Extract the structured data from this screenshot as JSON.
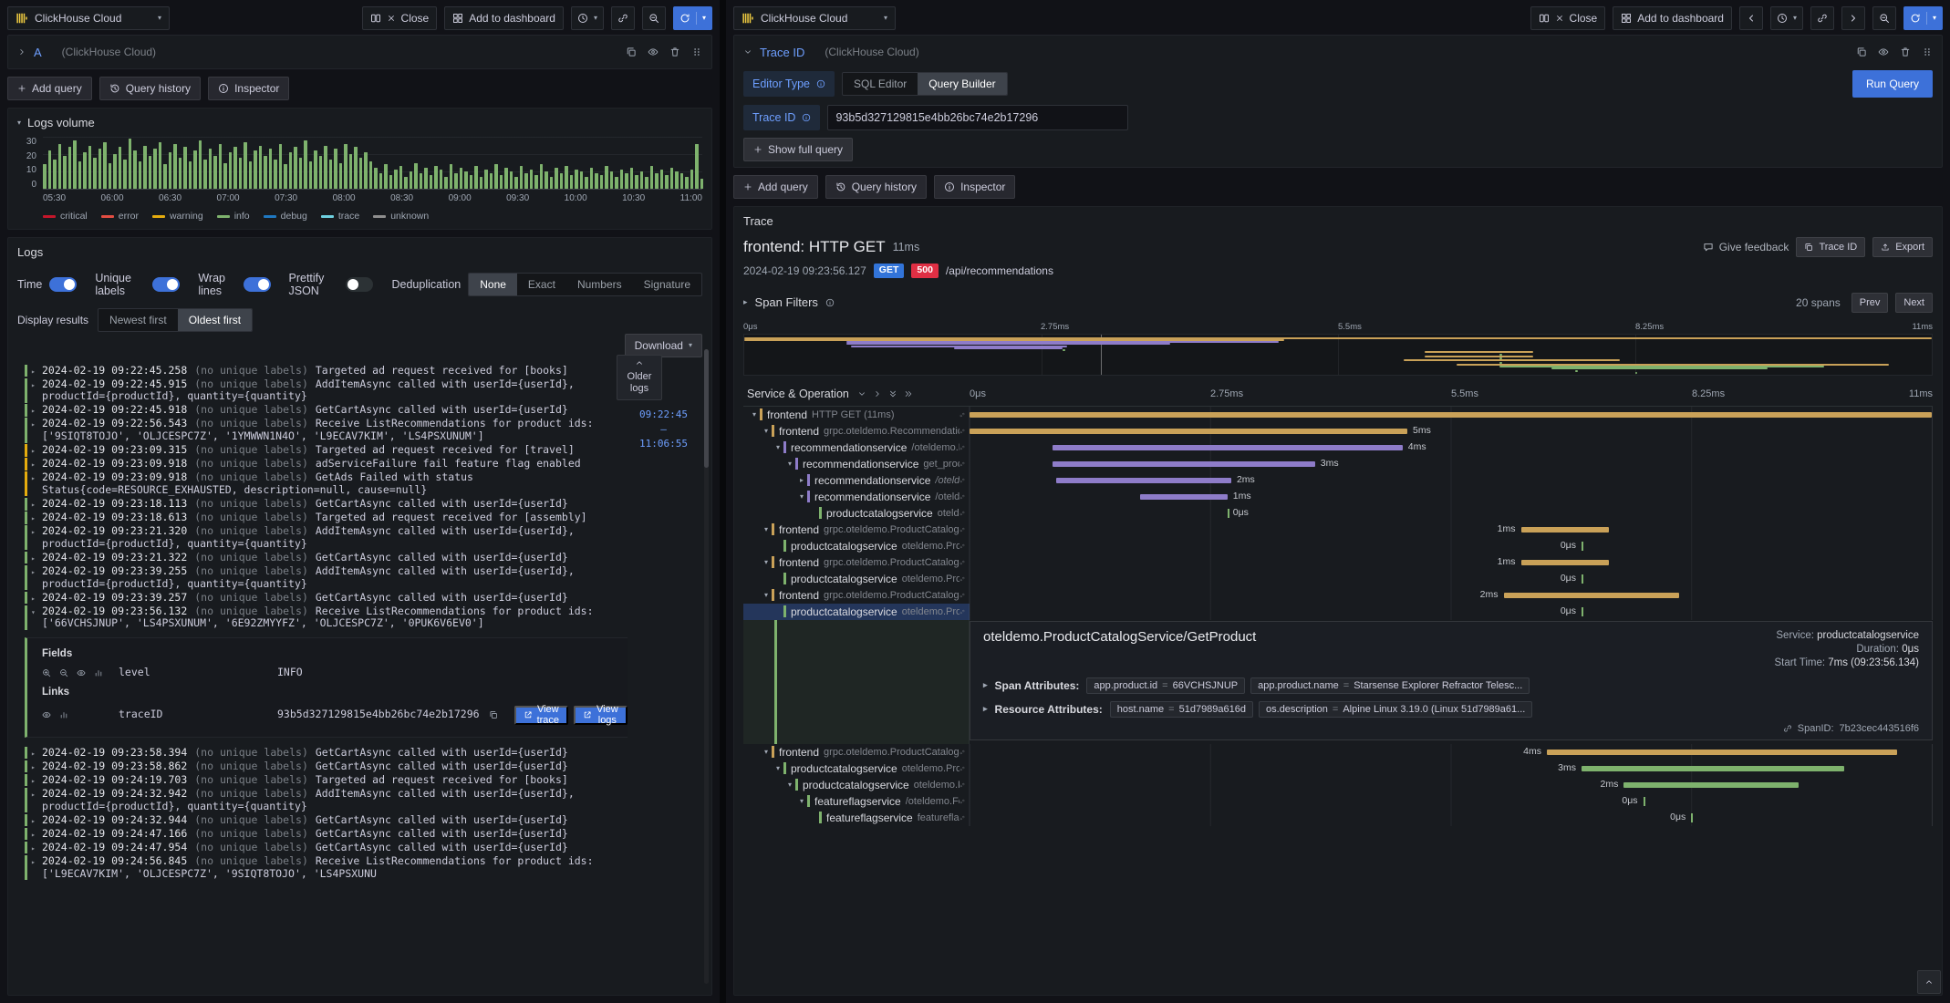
{
  "colors": {
    "accent_blue": "#3d71d9",
    "link_blue": "#6e9fff",
    "method_get": "#3274d9",
    "status_500": "#e02f44",
    "log_levels": {
      "critical": "#c4162a",
      "error": "#e24d42",
      "warning": "#e5ac0e",
      "info": "#7eb26d",
      "debug": "#1f78c1",
      "trace": "#6ed0e0",
      "unknown": "#8e8e8e"
    },
    "services": {
      "tan": "#c9a158",
      "purple": "#8e7cc9",
      "green": "#7eb26d"
    }
  },
  "chart_data": {
    "type": "bar",
    "title": "Logs volume",
    "xlabel": "time",
    "ylabel": "",
    "x_ticks": [
      "05:30",
      "06:00",
      "06:30",
      "07:00",
      "07:30",
      "08:00",
      "08:30",
      "09:00",
      "09:30",
      "10:00",
      "10:30",
      "11:00"
    ],
    "ylim": [
      0,
      30
    ],
    "y_ticks": [
      "30",
      "20",
      "10",
      "0"
    ],
    "legend": [
      "critical",
      "error",
      "warning",
      "info",
      "debug",
      "trace",
      "unknown"
    ],
    "legend_position": "bottom",
    "grid": true,
    "series": [
      {
        "name": "info",
        "color": "#7eb26d",
        "values": [
          14,
          22,
          17,
          26,
          19,
          24,
          28,
          16,
          21,
          25,
          18,
          23,
          27,
          15,
          20,
          24,
          17,
          29,
          22,
          16,
          25,
          19,
          23,
          27,
          14,
          21,
          26,
          18,
          24,
          16,
          22,
          28,
          17,
          23,
          19,
          26,
          15,
          21,
          24,
          18,
          27,
          16,
          22,
          25,
          19,
          23,
          17,
          26,
          14,
          21,
          24,
          18,
          28,
          16,
          22,
          19,
          25,
          17,
          23,
          15,
          26,
          20,
          24,
          18,
          21,
          16,
          12,
          9,
          14,
          8,
          11,
          13,
          7,
          10,
          15,
          9,
          12,
          8,
          13,
          11,
          7,
          14,
          9,
          12,
          10,
          8,
          13,
          7,
          11,
          9,
          14,
          8,
          12,
          10,
          7,
          13,
          9,
          11,
          8,
          14,
          10,
          7,
          12,
          9,
          13,
          8,
          11,
          10,
          7,
          12,
          9,
          8,
          13,
          10,
          7,
          11,
          9,
          12,
          8,
          10,
          7,
          13,
          9,
          11,
          8,
          12,
          10,
          9,
          7,
          11,
          26,
          6
        ]
      }
    ]
  },
  "left": {
    "toolbar": {
      "datasource": "ClickHouse Cloud",
      "close": "Close",
      "add_to_dashboard": "Add to dashboard"
    },
    "query": {
      "ref_id": "A",
      "hint": "(ClickHouse Cloud)"
    },
    "actions": {
      "add_query": "Add query",
      "query_history": "Query history",
      "inspector": "Inspector"
    },
    "logs_volume": {
      "title": "Logs volume"
    },
    "logs": {
      "title": "Logs",
      "controls": {
        "time": "Time",
        "unique_labels": "Unique labels",
        "wrap_lines": "Wrap lines",
        "prettify_json": "Prettify JSON",
        "deduplication": "Deduplication",
        "dedup_options": [
          "None",
          "Exact",
          "Numbers",
          "Signature"
        ],
        "dedup_selected": "None",
        "display_results": "Display results",
        "order_options": [
          "Newest first",
          "Oldest first"
        ],
        "order_selected": "Oldest first",
        "download": "Download"
      },
      "older_logs": "Older logs",
      "time_range": {
        "from": "09:22:45",
        "dash": "—",
        "to": "11:06:55"
      },
      "no_labels": "(no unique labels)",
      "rows": [
        {
          "ts": "2024-02-19 09:22:45.258",
          "msg": "Targeted ad request received for [books]",
          "level": "info"
        },
        {
          "ts": "2024-02-19 09:22:45.915",
          "msg": "AddItemAsync called with userId={userId}, productId={productId}, quantity={quantity}",
          "level": "info"
        },
        {
          "ts": "2024-02-19 09:22:45.918",
          "msg": "GetCartAsync called with userId={userId}",
          "level": "info"
        },
        {
          "ts": "2024-02-19 09:22:56.543",
          "msg": "Receive ListRecommendations for product ids:['9SIQT8TOJO', 'OLJCESPC7Z', '1YMWWN1N4O', 'L9ECAV7KIM', 'LS4PSXUNUM']",
          "level": "info"
        },
        {
          "ts": "2024-02-19 09:23:09.315",
          "msg": "Targeted ad request received for [travel]",
          "level": "warning"
        },
        {
          "ts": "2024-02-19 09:23:09.918",
          "msg": "adServiceFailure fail feature flag enabled",
          "level": "warning"
        },
        {
          "ts": "2024-02-19 09:23:09.918",
          "msg": "GetAds Failed with status Status{code=RESOURCE_EXHAUSTED, description=null, cause=null}",
          "level": "warning"
        },
        {
          "ts": "2024-02-19 09:23:18.113",
          "msg": "GetCartAsync called with userId={userId}",
          "level": "info"
        },
        {
          "ts": "2024-02-19 09:23:18.613",
          "msg": "Targeted ad request received for [assembly]",
          "level": "info"
        },
        {
          "ts": "2024-02-19 09:23:21.320",
          "msg": "AddItemAsync called with userId={userId}, productId={productId}, quantity={quantity}",
          "level": "info"
        },
        {
          "ts": "2024-02-19 09:23:21.322",
          "msg": "GetCartAsync called with userId={userId}",
          "level": "info"
        },
        {
          "ts": "2024-02-19 09:23:39.255",
          "msg": "AddItemAsync called with userId={userId}, productId={productId}, quantity={quantity}",
          "level": "info"
        },
        {
          "ts": "2024-02-19 09:23:39.257",
          "msg": "GetCartAsync called with userId={userId}",
          "level": "info"
        },
        {
          "ts": "2024-02-19 09:23:56.132",
          "msg": "Receive ListRecommendations for product ids:['66VCHSJNUP', 'LS4PSXUNUM', '6E92ZMYYFZ', 'OLJCESPC7Z', '0PUK6V6EV0']",
          "level": "info",
          "expanded": true
        }
      ],
      "detail": {
        "fields_title": "Fields",
        "fields": [
          {
            "key": "level",
            "value": "INFO"
          }
        ],
        "links_title": "Links",
        "links": [
          {
            "key": "traceID",
            "value": "93b5d327129815e4bb26bc74e2b17296"
          }
        ],
        "view_trace": "View trace",
        "view_logs": "View logs"
      },
      "rows_after": [
        {
          "ts": "2024-02-19 09:23:58.394",
          "msg": "GetCartAsync called with userId={userId}",
          "level": "info"
        },
        {
          "ts": "2024-02-19 09:23:58.862",
          "msg": "GetCartAsync called with userId={userId}",
          "level": "info"
        },
        {
          "ts": "2024-02-19 09:24:19.703",
          "msg": "Targeted ad request received for [books]",
          "level": "info"
        },
        {
          "ts": "2024-02-19 09:24:32.942",
          "msg": "AddItemAsync called with userId={userId}, productId={productId}, quantity={quantity}",
          "level": "info"
        },
        {
          "ts": "2024-02-19 09:24:32.944",
          "msg": "GetCartAsync called with userId={userId}",
          "level": "info"
        },
        {
          "ts": "2024-02-19 09:24:47.166",
          "msg": "GetCartAsync called with userId={userId}",
          "level": "info"
        },
        {
          "ts": "2024-02-19 09:24:47.954",
          "msg": "GetCartAsync called with userId={userId}",
          "level": "info"
        },
        {
          "ts": "2024-02-19 09:24:56.845",
          "msg": "Receive ListRecommendations for product ids:['L9ECAV7KIM', 'OLJCESPC7Z', '9SIQT8TOJO', 'LS4PSXUNU",
          "level": "info"
        }
      ]
    }
  },
  "right": {
    "toolbar": {
      "datasource": "ClickHouse Cloud",
      "close": "Close",
      "add_to_dashboard": "Add to dashboard"
    },
    "query": {
      "ref_id": "Trace ID",
      "hint": "(ClickHouse Cloud)",
      "editor_type_label": "Editor Type",
      "editor_modes": [
        "SQL Editor",
        "Query Builder"
      ],
      "editor_selected": "Query Builder",
      "run_query": "Run Query",
      "trace_id_label": "Trace ID",
      "trace_id_value": "93b5d327129815e4bb26bc74e2b17296",
      "show_full_query": "Show full query",
      "add_query": "Add query",
      "query_history": "Query history",
      "inspector": "Inspector"
    },
    "trace": {
      "panel_title": "Trace",
      "title": "frontend: HTTP GET",
      "duration": "11ms",
      "timestamp": "2024-02-19 09:23:56.127",
      "method": "GET",
      "status": "500",
      "url": "/api/recommendations",
      "give_feedback": "Give feedback",
      "trace_id_button": "Trace ID",
      "export": "Export",
      "span_filters": "Span Filters",
      "span_count": "20 spans",
      "prev": "Prev",
      "next": "Next",
      "table_header": "Service & Operation",
      "axis_ticks": [
        "0μs",
        "2.75ms",
        "5.5ms",
        "8.25ms",
        "11ms"
      ],
      "spans_before": [
        {
          "service": "frontend",
          "operation": "HTTP GET (11ms)",
          "depth": 0,
          "start": 0,
          "width": 1,
          "c": "tan",
          "label": "",
          "side": "right",
          "chev": "v"
        },
        {
          "service": "frontend",
          "operation": "grpc.oteldemo.RecommendationServi...",
          "depth": 1,
          "start": 0,
          "width": 0.455,
          "c": "tan",
          "label": "5ms",
          "side": "right",
          "chev": "v"
        },
        {
          "service": "recommendationservice",
          "operation": "/oteldemo.Rec...",
          "depth": 2,
          "start": 0.086,
          "width": 0.364,
          "c": "purple",
          "label": "4ms",
          "side": "right",
          "chev": "v"
        },
        {
          "service": "recommendationservice",
          "operation": "get_produc...",
          "depth": 3,
          "start": 0.086,
          "width": 0.273,
          "c": "purple",
          "label": "3ms",
          "side": "right",
          "chev": "v"
        },
        {
          "service": "recommendationservice",
          "operation": "/otelde...",
          "depth": 4,
          "start": 0.09,
          "width": 0.182,
          "c": "purple",
          "label": "2ms",
          "side": "right",
          "chev": "r",
          "italic": true
        },
        {
          "service": "recommendationservice",
          "operation": "/otelde...",
          "depth": 4,
          "start": 0.177,
          "width": 0.091,
          "c": "purple",
          "label": "1ms",
          "side": "right",
          "chev": "v"
        },
        {
          "service": "productcatalogservice",
          "operation": "oteld...",
          "depth": 5,
          "start": 0.268,
          "width": 0,
          "c": "green",
          "label": "0μs",
          "side": "right",
          "chev": ""
        },
        {
          "service": "frontend",
          "operation": "grpc.oteldemo.ProductCatalogService",
          "depth": 1,
          "start": 0.573,
          "width": 0.091,
          "c": "tan",
          "label": "1ms",
          "side": "left",
          "chev": "v"
        },
        {
          "service": "productcatalogservice",
          "operation": "oteldemo.Produc...",
          "depth": 2,
          "start": 0.636,
          "width": 0,
          "c": "green",
          "label": "0μs",
          "side": "left",
          "chev": ""
        },
        {
          "service": "frontend",
          "operation": "grpc.oteldemo.ProductCatalogService",
          "depth": 1,
          "start": 0.573,
          "width": 0.091,
          "c": "tan",
          "label": "1ms",
          "side": "left",
          "chev": "v"
        },
        {
          "service": "productcatalogservice",
          "operation": "oteldemo.Produc...",
          "depth": 2,
          "start": 0.636,
          "width": 0,
          "c": "green",
          "label": "0μs",
          "side": "left",
          "chev": ""
        },
        {
          "service": "frontend",
          "operation": "grpc.oteldemo.ProductCatalogService",
          "depth": 1,
          "start": 0.555,
          "width": 0.182,
          "c": "tan",
          "label": "2ms",
          "side": "left",
          "chev": "v"
        },
        {
          "service": "productcatalogservice",
          "operation": "oteldemo.Produc...",
          "depth": 2,
          "start": 0.636,
          "width": 0,
          "c": "green",
          "label": "0μs",
          "side": "left",
          "chev": "",
          "selected": true
        }
      ],
      "spans_after": [
        {
          "service": "frontend",
          "operation": "grpc.oteldemo.ProductCatalogService",
          "depth": 1,
          "start": 0.6,
          "width": 0.364,
          "c": "tan",
          "label": "4ms",
          "side": "left",
          "chev": "v"
        },
        {
          "service": "productcatalogservice",
          "operation": "oteldemo.Produc...",
          "depth": 2,
          "start": 0.636,
          "width": 0.273,
          "c": "green",
          "label": "3ms",
          "side": "left",
          "chev": "v"
        },
        {
          "service": "productcatalogservice",
          "operation": "oteldemo.Fea...",
          "depth": 3,
          "start": 0.68,
          "width": 0.182,
          "c": "green",
          "label": "2ms",
          "side": "left",
          "chev": "v"
        },
        {
          "service": "featureflagservice",
          "operation": "/oteldemo.Feat...",
          "depth": 4,
          "start": 0.7,
          "width": 0,
          "c": "green",
          "label": "0μs",
          "side": "left",
          "chev": "v"
        },
        {
          "service": "featureflagservice",
          "operation": "featureflag...",
          "depth": 5,
          "start": 0.75,
          "width": 0,
          "c": "green",
          "label": "0μs",
          "side": "left",
          "chev": ""
        }
      ],
      "detail": {
        "title": "oteldemo.ProductCatalogService/GetProduct",
        "service_label": "Service:",
        "service": "productcatalogservice",
        "duration_label": "Duration:",
        "duration": "0μs",
        "start_label": "Start Time:",
        "start": "7ms (09:23:56.134)",
        "span_attrs_label": "Span Attributes:",
        "span_attrs": [
          {
            "k": "app.product.id",
            "v": "66VCHSJNUP"
          },
          {
            "k": "app.product.name",
            "v": "Starsense Explorer Refractor Telesc..."
          }
        ],
        "res_attrs_label": "Resource Attributes:",
        "res_attrs": [
          {
            "k": "host.name",
            "v": "51d7989a616d"
          },
          {
            "k": "os.description",
            "v": "Alpine Linux 3.19.0 (Linux 51d7989a61..."
          }
        ],
        "span_id_label": "SpanID:",
        "span_id": "7b23cec443516f6"
      }
    }
  }
}
